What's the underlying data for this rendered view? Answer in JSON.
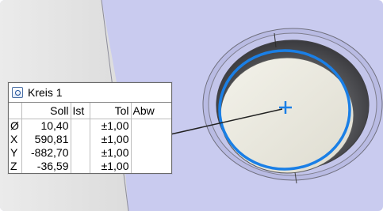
{
  "callout": {
    "title": "Kreis 1",
    "icon": "circle-feature-icon",
    "columns": [
      "",
      "Soll",
      "Ist",
      "Tol",
      "Abw"
    ],
    "rows": [
      {
        "axis": "Ø",
        "soll": "10,40",
        "ist": "",
        "tol": "±1,00",
        "abw": ""
      },
      {
        "axis": "X",
        "soll": "590,81",
        "ist": "",
        "tol": "±1,00",
        "abw": ""
      },
      {
        "axis": "Y",
        "soll": "-882,70",
        "ist": "",
        "tol": "±1,00",
        "abw": ""
      },
      {
        "axis": "Z",
        "soll": "-36,59",
        "ist": "",
        "tol": "±1,00",
        "abw": ""
      }
    ]
  },
  "colors": {
    "part_surface": "#c9cbef",
    "part_surface_dark": "#a9abd8",
    "left_panel": "#e3e3e3",
    "circle_highlight": "#1a7fe6",
    "center_marker": "#1a7fe6",
    "leader_line": "#222222"
  }
}
